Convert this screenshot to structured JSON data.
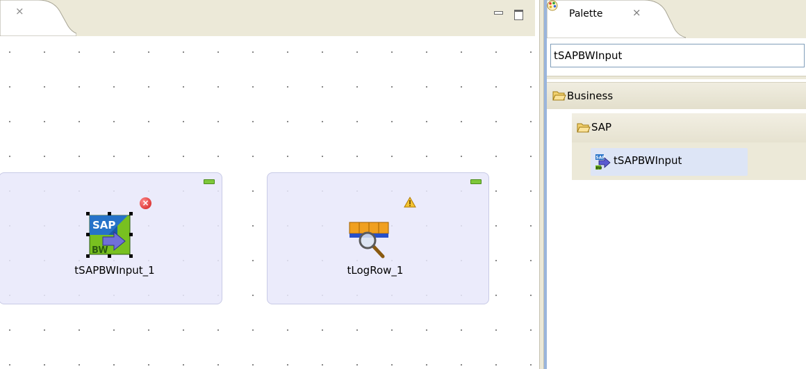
{
  "editor": {
    "tab_close_glyph": "⨯",
    "components": [
      {
        "label": "tSAPBWInput_1",
        "icon": "sap-bw-icon",
        "status": "error"
      },
      {
        "label": "tLogRow_1",
        "icon": "log-row-icon",
        "status": "warning"
      }
    ],
    "error_glyph": "×"
  },
  "palette": {
    "tab_title": "Palette",
    "tab_close_glyph": "⨯",
    "search_value": "tSAPBWInput",
    "drawer_business": "Business",
    "drawer_sap": "SAP",
    "item_label": "tSAPBWInput"
  },
  "colors": {
    "component_bg": "#e8e8fa",
    "selection": "#dde5f6",
    "error": "#d01818",
    "warning": "#e8a000",
    "minimize": "#7ec83a"
  }
}
